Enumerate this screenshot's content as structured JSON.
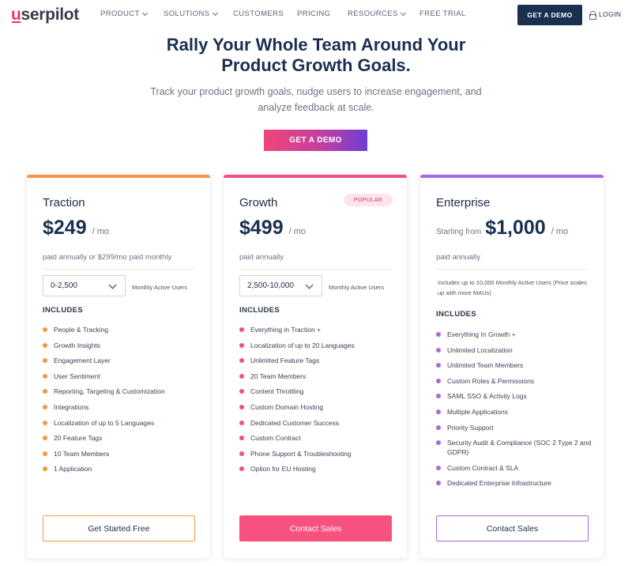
{
  "header": {
    "logo_first": "u",
    "logo_rest": "serpilot",
    "menu": [
      {
        "label": "PRODUCT",
        "dropdown": true
      },
      {
        "label": "SOLUTIONS",
        "dropdown": true
      },
      {
        "label": "CUSTOMERS",
        "dropdown": false
      },
      {
        "label": "PRICING",
        "dropdown": false
      },
      {
        "label": "RESOURCES",
        "dropdown": true
      },
      {
        "label": "FREE TRIAL",
        "dropdown": false
      }
    ],
    "demo_button": "GET A DEMO",
    "login": "LOGIN"
  },
  "hero": {
    "title_line1": "Rally Your Whole Team Around Your",
    "title_line2": "Product Growth Goals.",
    "subtitle_line1": "Track your product growth goals, nudge users to increase engagement, and",
    "subtitle_line2": "analyze feedback at scale.",
    "cta": "GET A DEMO"
  },
  "colors": {
    "traction": "#f5964a",
    "growth": "#f0527e",
    "enterprise": "#a76ae6",
    "navy": "#1b3051"
  },
  "plans": [
    {
      "name": "Traction",
      "price": "$249",
      "per": "/ mo",
      "billing": "paid annually or $299/mo paid monthly",
      "mau_value": "0-2,500",
      "mau_label": "Monthly Active Users",
      "includes": "INCLUDES",
      "features": [
        "People & Tracking",
        "Growth Insights",
        "Engagement Layer",
        "User Sentiment",
        "Reporting, Targeting & Customization",
        "Integrations",
        "Localization of up to 5 Languages",
        "20 Feature Tags",
        "10 Team Members",
        "1 Application"
      ],
      "cta": "Get Started Free"
    },
    {
      "name": "Growth",
      "badge": "POPULAR",
      "price": "$499",
      "per": "/ mo",
      "billing": "paid annually",
      "mau_value": "2,500-10,000",
      "mau_label": "Monthly Active Users",
      "includes": "INCLUDES",
      "features": [
        "Everything in Traction +",
        "Localization of up to 20 Languages",
        "Unlimited Feature Tags",
        "20 Team Members",
        "Content Throttling",
        "Custom Domain Hosting",
        "Dedicated Customer Success",
        "Custom Contract",
        "Phone Support & Troubleshooting",
        "Option for EU Hosting"
      ],
      "cta": "Contact Sales"
    },
    {
      "name": "Enterprise",
      "starting": "Starting from",
      "price": "$1,000",
      "per": "/ mo",
      "billing": "paid annually",
      "mau_note": "Includes up to 10,000 Monthly Active Users (Price scales up with more MAUs)",
      "includes": "INCLUDES",
      "features": [
        "Everything In Growth +",
        "Unlimited Localization",
        "Unlimited Team Members",
        "Custom Roles & Permissions",
        "SAML SSO & Activity Logs",
        "Multiple Applications",
        "Priority Support",
        "Security Audit & Compliance (SOC 2 Type 2 and GDPR)",
        "Custom Contract & SLA",
        "Dedicated Enterprise Infrastructure"
      ],
      "cta": "Contact Sales"
    }
  ]
}
